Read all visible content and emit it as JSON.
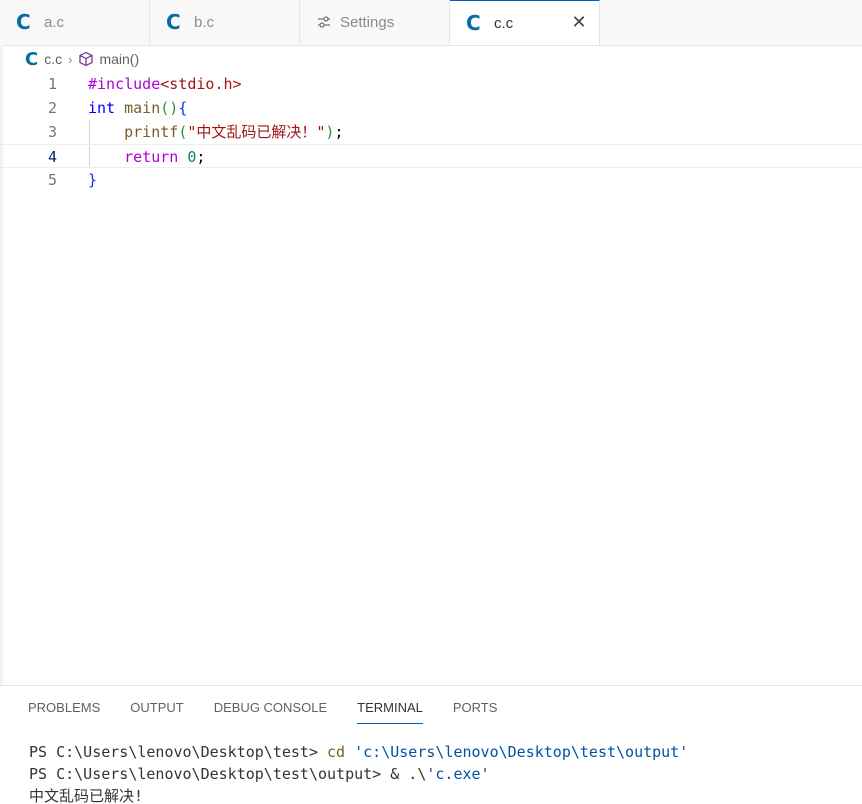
{
  "tabs": [
    {
      "label": "a.c",
      "icon": "c-file-icon",
      "active": false
    },
    {
      "label": "b.c",
      "icon": "c-file-icon",
      "active": false
    },
    {
      "label": "Settings",
      "icon": "settings-sliders-icon",
      "active": false
    },
    {
      "label": "c.c",
      "icon": "c-file-icon",
      "active": true
    }
  ],
  "breadcrumb": {
    "file": "c.c",
    "symbol": "main()"
  },
  "editor": {
    "active_line": 4,
    "lines": [
      {
        "n": "1",
        "directive": "#include",
        "header": "<stdio.h>"
      },
      {
        "n": "2",
        "type_kw": "int",
        "fn": "main",
        "open_paren": "(",
        "close_paren": ")",
        "open_brace": "{"
      },
      {
        "n": "3",
        "fn": "printf",
        "open_paren": "(",
        "string": "\"中文乱码已解决！\"",
        "close_paren": ")",
        "semi": ";"
      },
      {
        "n": "4",
        "ctrl_kw": "return",
        "num": "0",
        "semi": ";"
      },
      {
        "n": "5",
        "close_brace": "}"
      }
    ]
  },
  "panel": {
    "tabs": [
      "PROBLEMS",
      "OUTPUT",
      "DEBUG CONSOLE",
      "TERMINAL",
      "PORTS"
    ],
    "active_tab": "TERMINAL",
    "terminal": {
      "line1_prompt": "PS C:\\Users\\lenovo\\Desktop\\test> ",
      "line1_cmd": "cd",
      "line1_arg": "'c:\\Users\\lenovo\\Desktop\\test\\output'",
      "line2_prompt": "PS C:\\Users\\lenovo\\Desktop\\test\\output> ",
      "line2_op": "& .\\",
      "line2_arg": "'c.exe'",
      "line3_output": "中文乱码已解决!"
    }
  },
  "colors": {
    "c_icon": "#0a6aa6",
    "accent": "#005fb8"
  }
}
